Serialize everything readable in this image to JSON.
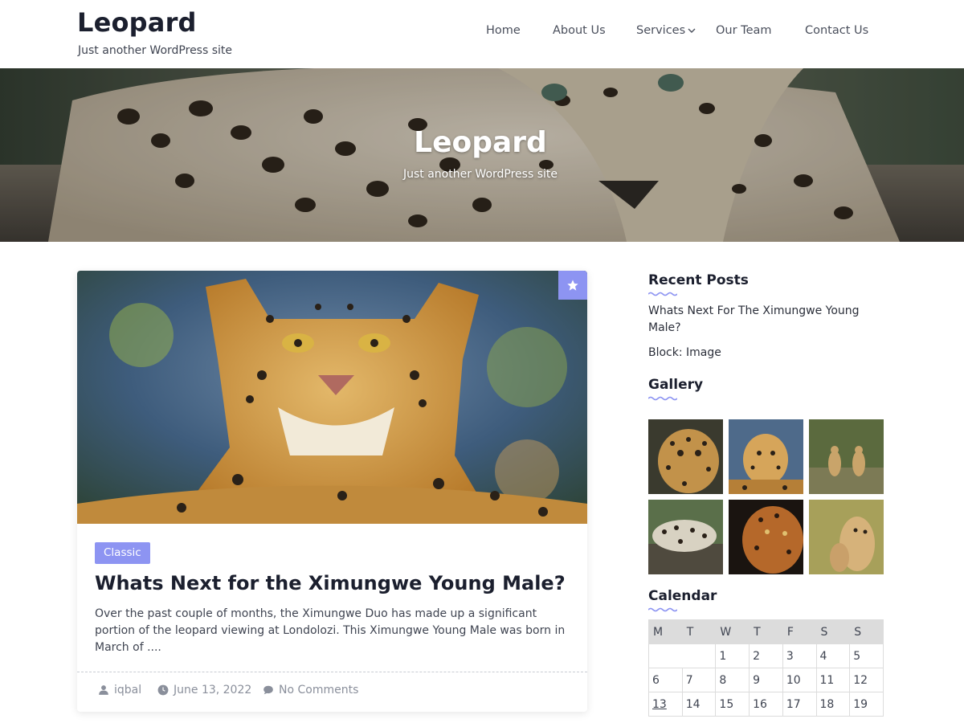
{
  "site": {
    "title": "Leopard",
    "tagline": "Just another WordPress site"
  },
  "nav": {
    "items": [
      {
        "label": "Home"
      },
      {
        "label": "About Us"
      },
      {
        "label": "Services"
      },
      {
        "label": "Our Team"
      },
      {
        "label": "Contact Us"
      }
    ]
  },
  "hero": {
    "title": "Leopard",
    "tagline": "Just another WordPress site"
  },
  "post": {
    "category": "Classic",
    "title": "Whats Next for the Ximungwe Young Male?",
    "excerpt": "Over the past couple of months, the Ximungwe Duo has made up a significant portion of the leopard viewing at Londolozi. This Ximungwe Young Male was born in March of ....",
    "author": "iqbal",
    "date": "June 13, 2022",
    "comments": "No Comments",
    "sticky_icon": "star-icon"
  },
  "sidebar": {
    "recent_posts": {
      "title": "Recent Posts",
      "items": [
        {
          "label": "Whats Next For The Ximungwe Young Male?"
        },
        {
          "label": "Block: Image"
        }
      ]
    },
    "gallery": {
      "title": "Gallery",
      "items": [
        {
          "name": "leopard-closeup"
        },
        {
          "name": "leopard-portrait"
        },
        {
          "name": "leopard-pair-grass"
        },
        {
          "name": "leopard-resting-log"
        },
        {
          "name": "leopard-dark-portrait"
        },
        {
          "name": "cheetah-grass"
        }
      ]
    },
    "calendar": {
      "title": "Calendar",
      "headers": [
        "M",
        "T",
        "W",
        "T",
        "F",
        "S",
        "S"
      ],
      "rows": [
        [
          "",
          "",
          "1",
          "2",
          "3",
          "4",
          "5"
        ],
        [
          "6",
          "7",
          "8",
          "9",
          "10",
          "11",
          "12"
        ],
        [
          "13",
          "14",
          "15",
          "16",
          "17",
          "18",
          "19"
        ]
      ],
      "linked_day": "13"
    }
  },
  "colors": {
    "accent": "#8d94f2",
    "heading": "#1b1f2e",
    "text": "#3f4451",
    "muted": "#8a8f9b"
  }
}
